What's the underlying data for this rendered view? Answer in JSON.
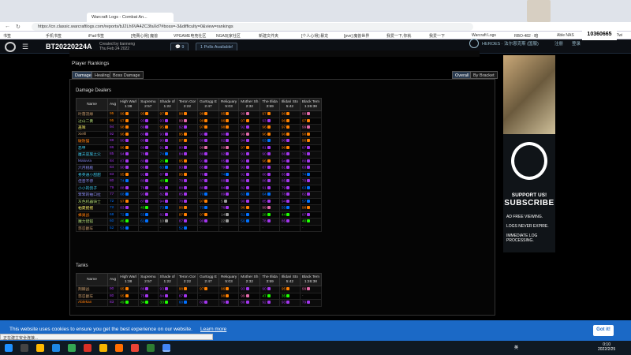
{
  "browser": {
    "tabs": [
      {
        "label": "Warcraft Logs - Combat An...",
        "active": true
      }
    ],
    "url": "https://cn.classic.warcraftlogs.com/reports/bJ2Lh6VA4ZC3faXd?#boss=-3&difficulty=0&view=rankings",
    "bookmarks": [
      "书签",
      "手机书签",
      "iPad书签",
      "[竞赛心得] 魔兽",
      "VPGAME电竞社区",
      "NGA玩家社区",
      "新建文件夹",
      "[个人心得] 暴龙",
      "[pve] 魔兽世界",
      "我爱一下,你就",
      "我爱一下",
      "Warcraft Logs",
      "RBO-482 · 暗",
      "Able NAS",
      "Mittyled · Twi"
    ]
  },
  "site": {
    "report_title": "BT20220224A",
    "created_by": "Created by tianneng",
    "created_date": "Thu Feb 24 2022",
    "comments_count": "9",
    "polls_label": "1 Polls Available!",
    "heroes_label": "HEROES · 法尔恩克斯 (国服)",
    "register_label": "注册",
    "login_label": "登录",
    "user_score": "10360665"
  },
  "rankings": {
    "heading": "Player Rankings",
    "tabs": [
      "Damage",
      "Healing",
      "Boss Damage"
    ],
    "right_tabs": [
      "Overall",
      "By Bracket"
    ],
    "dps_section": "Damage Dealers",
    "tank_section": "Tanks",
    "columns": [
      {
        "name": "Name"
      },
      {
        "name": "Avg"
      },
      {
        "name": "High Warl",
        "time": "1:38"
      },
      {
        "name": "Supremu",
        "time": "2:57"
      },
      {
        "name": "Shade of",
        "time": "1:22"
      },
      {
        "name": "Teron Gor",
        "time": "2:22"
      },
      {
        "name": "Gurtogg E",
        "time": "2:47"
      },
      {
        "name": "Reliquary",
        "time": "5:03"
      },
      {
        "name": "Mother Sh",
        "time": "2:32"
      },
      {
        "name": "The Illida",
        "time": "3:59"
      },
      {
        "name": "Illidari Sto",
        "time": "5:42"
      },
      {
        "name": "Black Tem",
        "time": "1:26:38"
      }
    ],
    "dps_rows": [
      {
        "name": "叶落流缘",
        "color": "#c69b6d",
        "avg": "95",
        "vals": [
          "96",
          "95",
          "97",
          "98",
          "98",
          "95",
          "99",
          "97",
          "96",
          "99"
        ]
      },
      {
        "name": "过山二黄",
        "color": "#aad372",
        "avg": "95",
        "vals": [
          "97",
          "93",
          "93",
          "99",
          "98",
          "96",
          "97",
          "93",
          "96",
          "97"
        ]
      },
      {
        "name": "巫咩",
        "color": "#fff468",
        "avg": "94",
        "vals": [
          "98",
          "89",
          "95",
          "92",
          "97",
          "98",
          "92",
          "96",
          "97",
          "99"
        ]
      },
      {
        "name": "Xielll",
        "color": "#c69b6d",
        "avg": "92",
        "vals": [
          "96",
          "80",
          "93",
          "95",
          "93",
          "90",
          "99",
          "96",
          "96",
          "98"
        ]
      },
      {
        "name": "破防猫",
        "color": "#ff7c0a",
        "avg": "88",
        "vals": [
          "90",
          "80",
          "90",
          "97",
          "80",
          "82",
          "94",
          "63",
          "90",
          "96"
        ]
      },
      {
        "name": "恐甲",
        "color": "#3fc7eb",
        "avg": "86",
        "vals": [
          "96",
          "89",
          "91",
          "90",
          "99",
          "99",
          "97",
          "81",
          "96",
          "87"
        ]
      },
      {
        "name": "屠夫巫施之父",
        "color": "#3fc7eb",
        "avg": "85",
        "vals": [
          "94",
          "78",
          "74",
          "84",
          "89",
          "92",
          "91",
          "90",
          "86",
          "76"
        ]
      },
      {
        "name": "Maluvra",
        "color": "#8788ee",
        "avg": "84",
        "vals": [
          "87",
          "80",
          "26",
          "95",
          "91",
          "85",
          "93",
          "96",
          "94",
          "80"
        ]
      },
      {
        "name": "六月桃桃",
        "color": "#8788ee",
        "avg": "84",
        "vals": [
          "90",
          "86",
          "63",
          "93",
          "85",
          "79",
          "93",
          "87",
          "81",
          "83"
        ]
      },
      {
        "name": "秀英通小甜甜",
        "color": "#3fc7eb",
        "avg": "83",
        "vals": [
          "95",
          "92",
          "87",
          "95",
          "78",
          "74",
          "92",
          "88",
          "85",
          "74"
        ]
      },
      {
        "name": "佳音不停",
        "color": "#8788ee",
        "avg": "80",
        "vals": [
          "74",
          "80",
          "48",
          "78",
          "87",
          "88",
          "89",
          "86",
          "85",
          "79"
        ]
      },
      {
        "name": "小小的鸽子",
        "color": "#3fc7eb",
        "avg": "79",
        "vals": [
          "88",
          "76",
          "82",
          "88",
          "80",
          "84",
          "82",
          "91",
          "79",
          "63"
        ]
      },
      {
        "name": "笨笨的袖口拉",
        "color": "#8788ee",
        "avg": "77",
        "vals": [
          "68",
          "93",
          "82",
          "85",
          "70",
          "89",
          "63",
          "64",
          "78",
          "82"
        ]
      },
      {
        "name": "灰色机器骑士",
        "color": "#aad372",
        "avg": "72",
        "vals": [
          "97",
          "87",
          "94",
          "78",
          "97",
          "5",
          "90",
          "85",
          "94",
          "57"
        ]
      },
      {
        "name": "帕夏摇摇",
        "color": "#fff468",
        "avg": "72",
        "vals": [
          "83",
          "45",
          "73",
          "96",
          "73",
          "76",
          "96",
          "99",
          "55",
          "98"
        ]
      },
      {
        "name": "蜂巢战",
        "color": "#ff7c0a",
        "avg": "68",
        "vals": [
          "72",
          "55",
          "82",
          "97",
          "97",
          "14",
          "51",
          "28",
          "44",
          "87"
        ]
      },
      {
        "name": "魔力猎狐",
        "color": "#aad372",
        "avg": "60",
        "vals": [
          "46",
          "61",
          "10",
          "87",
          "90",
          "22",
          "50",
          "78",
          "85",
          "40"
        ]
      },
      {
        "name": "怒忍翻车",
        "color": "#c69b6d",
        "avg": "52",
        "vals": [
          "53",
          "-",
          "-",
          "52",
          "-",
          "-",
          "-",
          "-",
          "-",
          "-"
        ]
      }
    ],
    "tank_rows": [
      {
        "name": "荆棘战",
        "color": "#c69b6d",
        "avg": "90",
        "vals": [
          "95",
          "86",
          "93",
          "98",
          "97",
          "96",
          "93",
          "90",
          "95",
          "99"
        ]
      },
      {
        "name": "怒忍翻车",
        "color": "#c69b6d",
        "avg": "80",
        "vals": [
          "95",
          "75",
          "84",
          "87",
          "-",
          "98",
          "99",
          "47",
          "35",
          "-"
        ]
      },
      {
        "name": "Ablekan",
        "color": "#ff7c0a",
        "avg": "83",
        "vals": [
          "49",
          "34",
          "33",
          "68",
          "83",
          "79",
          "88",
          "92",
          "93",
          "79"
        ]
      }
    ]
  },
  "ad": {
    "headline": "SUPPORT US!",
    "cta": "SUBSCRIBE",
    "bullets": [
      "AD FREE VIEWING.",
      "LOGS NEVER EXPIRE.",
      "IMMEDIATE LOG PROCESSING."
    ]
  },
  "cookie": {
    "text": "This website uses cookies to ensure you get the best experience on our website.",
    "learn_more": "Learn more",
    "button": "Got it!"
  },
  "status_text": "正在建立安全连接...",
  "taskbar": {
    "time": "0:10",
    "date": "2022/2/25",
    "lang": "英"
  }
}
